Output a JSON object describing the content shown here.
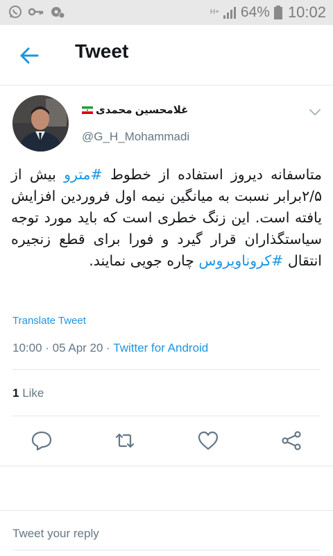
{
  "status_bar": {
    "network": "H+",
    "battery_percent": "64%",
    "time": "10:02"
  },
  "header": {
    "title": "Tweet"
  },
  "tweet": {
    "display_name": "غلامحسین محمدی",
    "handle": "@G_H_Mohammadi",
    "text_parts": {
      "p1": "متاسفانه دیروز استفاده از خطوط ",
      "hashtag1": "#مترو",
      "p2": " بیش از ۲/۵برابر نسبت به میانگین نیمه اول فروردین افزایش یافته است. این زنگ خطری است که باید مورد توجه سیاستگذاران قرار گیرد و فورا برای قطع زنجیره انتقال ",
      "hashtag2": "#کروناویروس",
      "p3": " چاره جویی نمایند."
    },
    "translate_label": "Translate Tweet",
    "time": "10:00",
    "date": "05 Apr 20",
    "separator": " · ",
    "client": "Twitter for Android",
    "like_count": "1",
    "like_label": " Like"
  },
  "reply": {
    "placeholder": "Tweet your reply"
  },
  "colors": {
    "accent": "#1b95e0",
    "secondary_text": "#657786",
    "divider": "#e1e8ed"
  },
  "icons": [
    "whatsapp-icon",
    "key-icon",
    "settings-badge-icon",
    "signal-icon",
    "battery-icon",
    "back-arrow-icon",
    "chevron-down-icon",
    "reply-icon",
    "retweet-icon",
    "like-icon",
    "share-icon"
  ]
}
